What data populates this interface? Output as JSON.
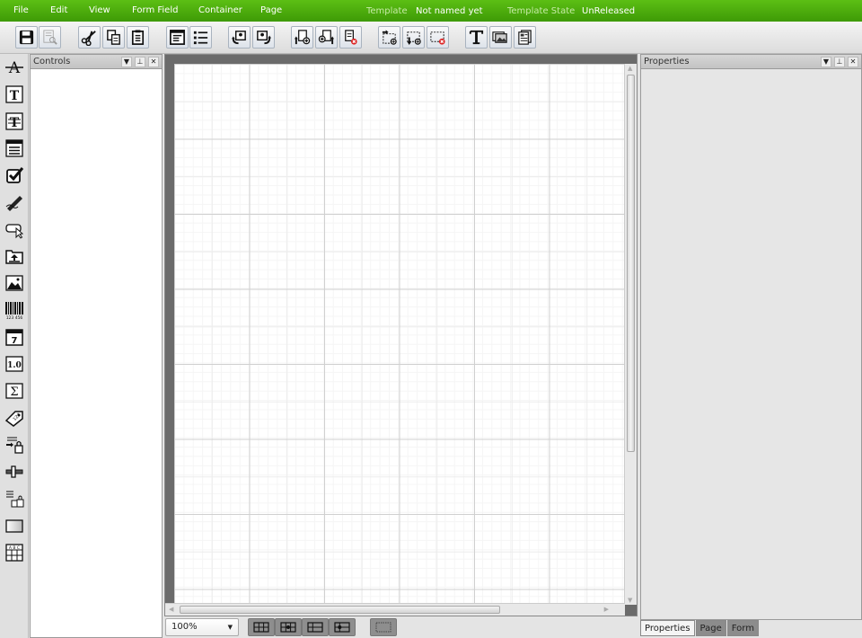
{
  "menu": {
    "items": [
      "File",
      "Edit",
      "View",
      "Form Field",
      "Container",
      "Page"
    ],
    "template_label": "Template",
    "template_value": "Not named yet",
    "state_label": "Template State",
    "state_value": "UnReleased"
  },
  "toolbar": {
    "buttons": [
      "save",
      "preview",
      "cut",
      "copy",
      "paste",
      "form-layout",
      "list-layout",
      "import",
      "export",
      "insert-page-before",
      "insert-page-after",
      "delete-page",
      "insert-container-right",
      "insert-container-below",
      "delete-container",
      "rename",
      "images",
      "page-view"
    ]
  },
  "controls_palette": {
    "icons": [
      "label",
      "text-field",
      "multiline-text",
      "list-box",
      "checkbox",
      "signature",
      "button",
      "file-upload",
      "image",
      "barcode",
      "date-picker",
      "numeric",
      "calculated",
      "tag",
      "lock-field",
      "slider",
      "group-lock",
      "rectangle",
      "table"
    ]
  },
  "controls_panel": {
    "title": "Controls"
  },
  "properties_panel": {
    "title": "Properties",
    "tabs": [
      {
        "label": "Properties",
        "active": true
      },
      {
        "label": "Page",
        "active": false
      },
      {
        "label": "Form",
        "active": false
      }
    ]
  },
  "panel_buttons": {
    "menu": "▼",
    "pin": "⊥",
    "close": "✕"
  },
  "canvas": {
    "zoom": "100%",
    "zoom_dropdown": "▼",
    "layout_buttons": [
      "grid-3x2",
      "grid-center-point",
      "grid-2-rows",
      "grid-row-point",
      "selection-box"
    ]
  }
}
